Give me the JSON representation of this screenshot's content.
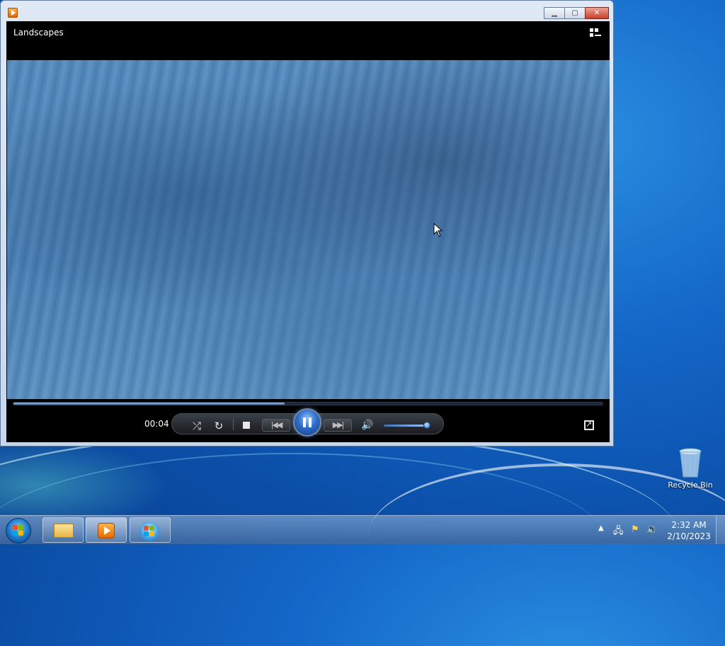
{
  "window": {
    "title": "Landscapes",
    "minimize_label": "▁",
    "maximize_label": "▢",
    "close_label": "✕"
  },
  "player": {
    "elapsed_time": "00:04",
    "seek_progress": 0.46,
    "volume_level": 0.95,
    "state": "playing"
  },
  "icons": {
    "app": "windows-media-player-icon",
    "switch_to_library": "switch-to-library-icon",
    "shuffle": "shuffle-icon",
    "repeat": "repeat-icon",
    "stop": "stop-icon",
    "previous": "previous-icon",
    "pause": "pause-icon",
    "next": "next-icon",
    "mute": "speaker-icon",
    "fullscreen": "fullscreen-icon"
  },
  "glyphs": {
    "shuffle": "⤮",
    "repeat": "↻",
    "previous": "|◀◀",
    "next": "▶▶|",
    "speaker": "🔊",
    "tray_up": "▲",
    "network": "🖧",
    "flag": "⚑",
    "volume": "🔉"
  },
  "desktop": {
    "recycle_bin_label": "Recycle Bin"
  },
  "taskbar": {
    "pinned": [
      "windows-explorer",
      "windows-media-player",
      "windows-update"
    ],
    "clock_time": "2:32 AM",
    "clock_date": "2/10/2023"
  },
  "colors": {
    "accent": "#2e6dc9",
    "desktop": "#1467c8"
  }
}
